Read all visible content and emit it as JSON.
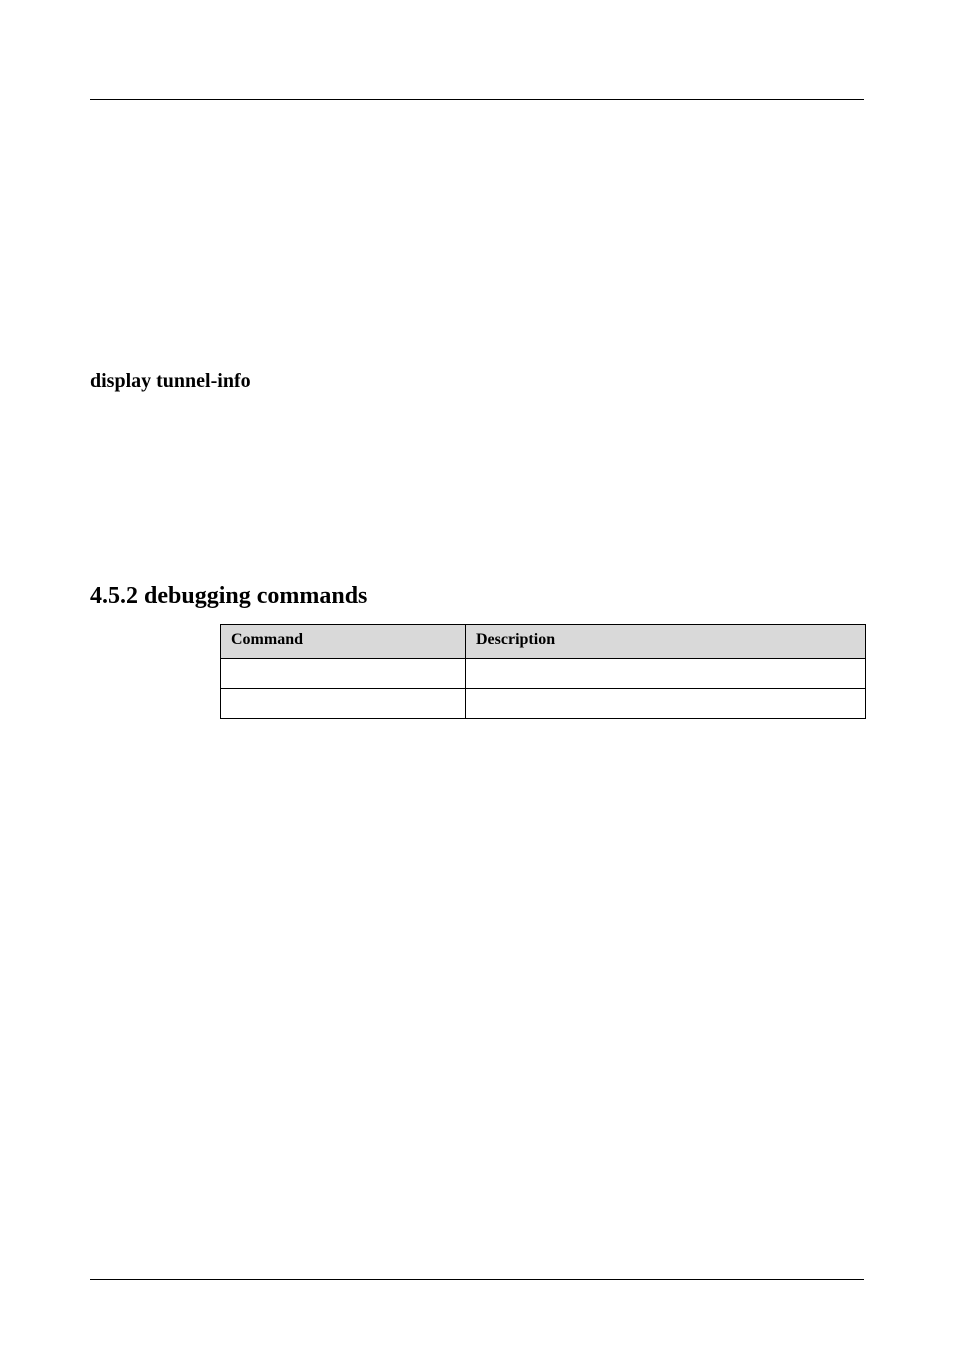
{
  "commands": {
    "display_tunnel_info": {
      "title": "display tunnel-info"
    }
  },
  "section": {
    "title": "4.5.2 debugging commands"
  },
  "table": {
    "headers": {
      "command": "Command",
      "description": "Description"
    },
    "rows": [
      {
        "command": "",
        "description": ""
      },
      {
        "command": "",
        "description": ""
      }
    ]
  }
}
